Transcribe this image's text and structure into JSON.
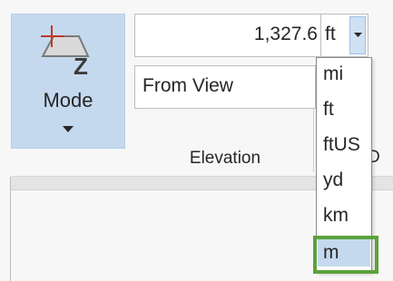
{
  "mode_button": {
    "label": "Mode",
    "icon": "elevation-mode-icon"
  },
  "elevation": {
    "value": "1,327.6",
    "unit": "ft",
    "reference": "From View",
    "group_label": "Elevation"
  },
  "clipped_label": "D",
  "unit_dropdown": {
    "options": [
      "mi",
      "ft",
      "ftUS",
      "yd",
      "km",
      "m"
    ],
    "highlighted": "m"
  },
  "colors": {
    "selected_bg": "#c5d9ee",
    "highlight_border": "#5aa33a"
  }
}
